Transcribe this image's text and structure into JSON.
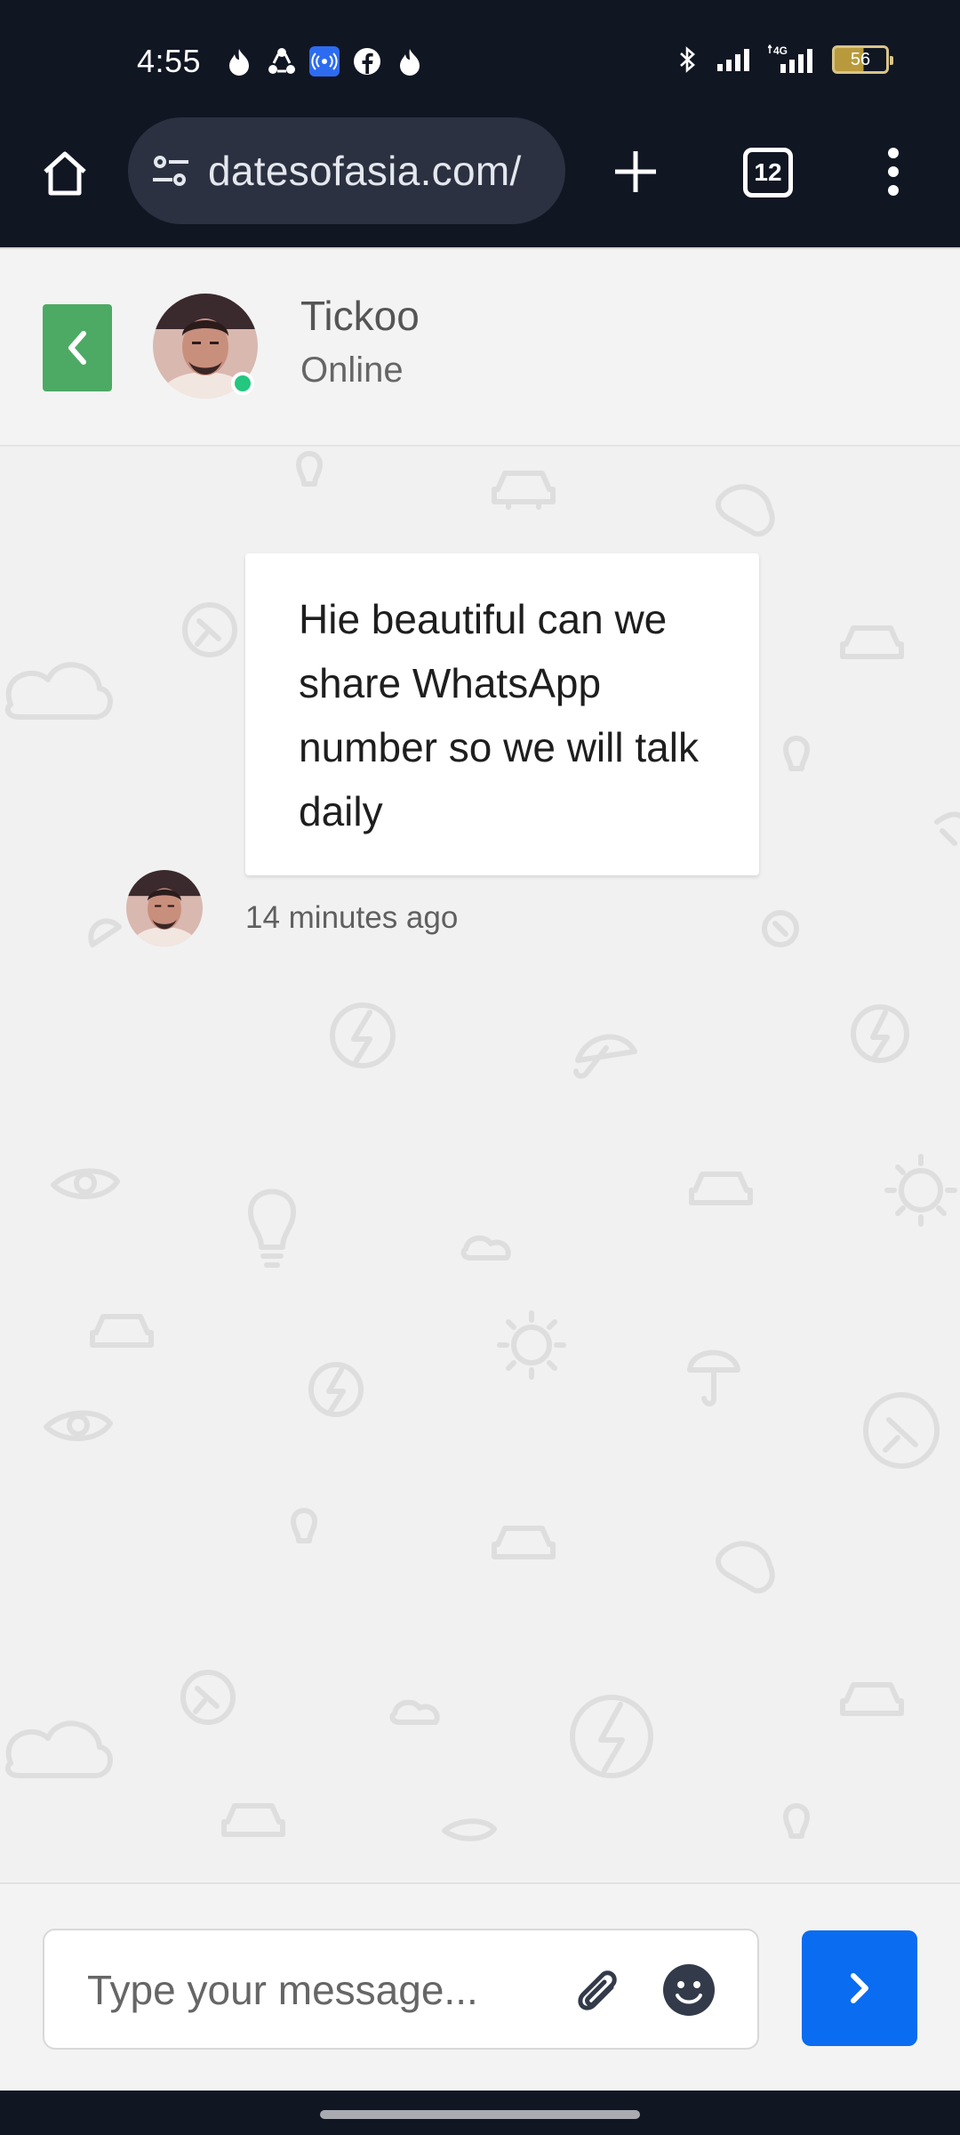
{
  "status_bar": {
    "time": "4:55",
    "battery_level": "56",
    "icons_left": [
      "flame-icon",
      "recycle-icon",
      "hotspot-icon",
      "facebook-icon",
      "flame-icon"
    ],
    "icons_right": [
      "bluetooth-icon",
      "signal-icon",
      "4g-signal-icon",
      "battery-icon"
    ]
  },
  "browser": {
    "url": "datesofasia.com/",
    "tab_count": "12"
  },
  "chat": {
    "contact_name": "Tickoo",
    "contact_status": "Online",
    "messages": [
      {
        "text": "Hie beautiful can we share WhatsApp number so we will talk daily",
        "time": "14 minutes ago"
      }
    ]
  },
  "composer": {
    "placeholder": "Type your message..."
  },
  "colors": {
    "back_button": "#4caa64",
    "send_button": "#0a6cf0",
    "online_dot": "#23c77f",
    "system_bar": "#111623"
  }
}
